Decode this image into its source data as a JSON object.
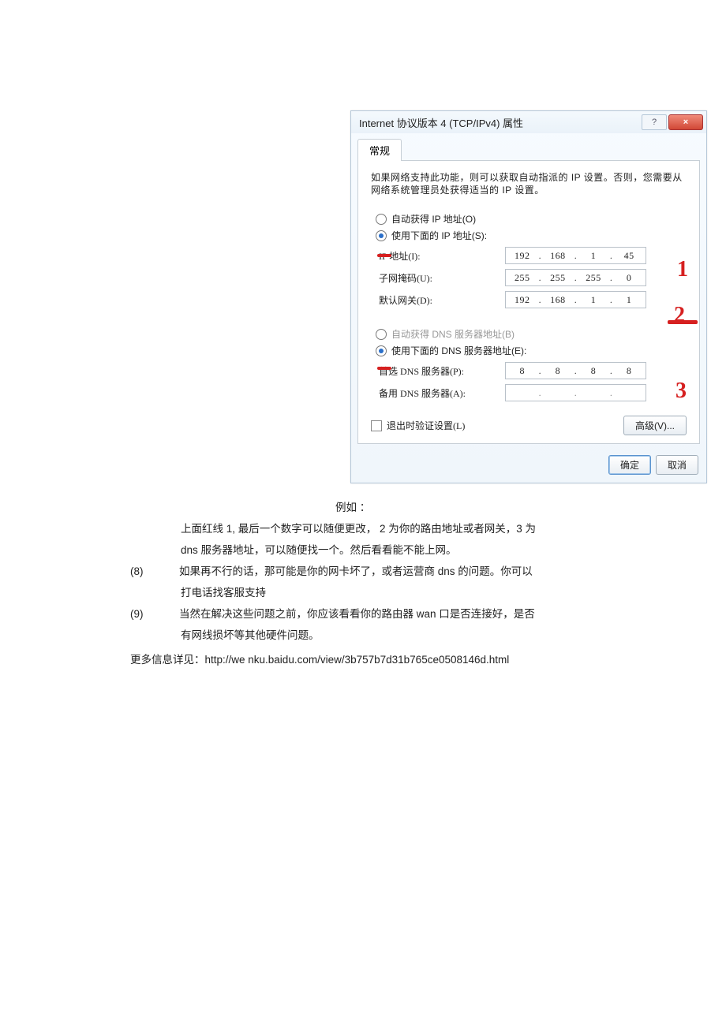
{
  "dialog": {
    "title": "Internet 协议版本 4 (TCP/IPv4) 属性",
    "tab": "常规",
    "description": "如果网络支持此功能，则可以获取自动指派的 IP 设置。否则，您需要从网络系统管理员处获得适当的 IP 设置。",
    "ip_section": {
      "auto_label": "自动获得 IP 地址(O)",
      "manual_label": "使用下面的 IP 地址(S):",
      "ip_label": "IP 地址(I):",
      "mask_label": "子网掩码(U):",
      "gateway_label": "默认网关(D):",
      "ip_value": {
        "a": "192",
        "b": "168",
        "c": "1",
        "d": "45"
      },
      "mask_value": {
        "a": "255",
        "b": "255",
        "c": "255",
        "d": "0"
      },
      "gateway_value": {
        "a": "192",
        "b": "168",
        "c": "1",
        "d": "1"
      }
    },
    "dns_section": {
      "auto_label": "自动获得 DNS 服务器地址(B)",
      "manual_label": "使用下面的 DNS 服务器地址(E):",
      "pref_label": "首选 DNS 服务器(P):",
      "alt_label": "备用 DNS 服务器(A):",
      "pref_value": {
        "a": "8",
        "b": "8",
        "c": "8",
        "d": "8"
      },
      "alt_value": {
        "a": "",
        "b": "",
        "c": "",
        "d": ""
      }
    },
    "validate_label": "退出时验证设置(L)",
    "advanced_label": "高级(V)...",
    "ok_label": "确定",
    "cancel_label": "取消",
    "help_glyph": "?",
    "close_glyph": "×"
  },
  "annotations": {
    "n1": "1",
    "n2": "2",
    "n3": "3"
  },
  "doc": {
    "example_prefix": "例如 ：",
    "line1": "上面红线 1, 最后一个数字可以随便更改，    2 为你的路由地址或者网关，3 为",
    "line2": "dns 服务器地址，可以随便找一个。然后看看能不能上网。",
    "item8_num": "(8)",
    "item8_a": "如果再不行的话，那可能是你的网卡坏了，或者运营商        dns 的问题。你可以",
    "item8_b": "打电话找客服支持",
    "item9_num": "(9)",
    "item9_a": "当然在解决这些问题之前，你应该看看你的路由器       wan 口是否连接好，是否",
    "item9_b": "有网线损坏等其他硬件问题。",
    "more": "更多信息详见：http://we nku.baidu.com/view/3b757b7d31b765ce0508146d.html"
  }
}
